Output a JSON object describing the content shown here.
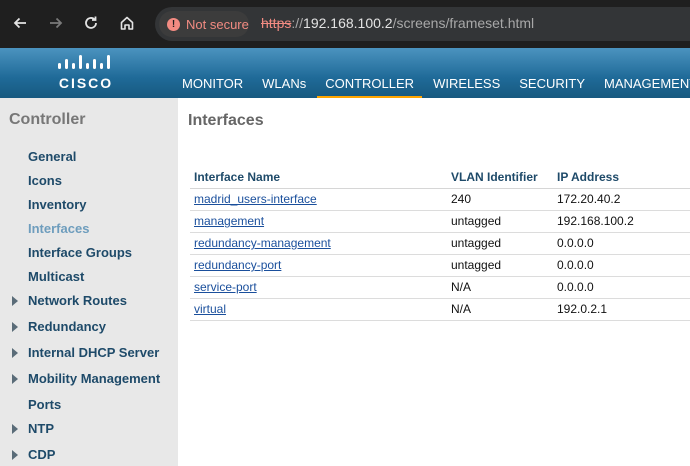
{
  "browser": {
    "security_label": "Not secure",
    "url_scheme": "https",
    "url_sep": "://",
    "url_host": "192.168.100.2",
    "url_path": "/screens/frameset.html"
  },
  "header": {
    "logo_text": "CISCO",
    "brand_color": "#1f6a98",
    "accent_color": "#ffa500",
    "nav": [
      {
        "label": "MONITOR"
      },
      {
        "label": "WLANs"
      },
      {
        "label": "CONTROLLER"
      },
      {
        "label": "WIRELESS"
      },
      {
        "label": "SECURITY"
      },
      {
        "label": "MANAGEMENT"
      }
    ],
    "active_nav": "CONTROLLER"
  },
  "sidebar": {
    "title": "Controller",
    "items": [
      {
        "label": "General",
        "expandable": false
      },
      {
        "label": "Icons",
        "expandable": false
      },
      {
        "label": "Inventory",
        "expandable": false
      },
      {
        "label": "Interfaces",
        "expandable": false,
        "active": true
      },
      {
        "label": "Interface Groups",
        "expandable": false
      },
      {
        "label": "Multicast",
        "expandable": false
      },
      {
        "label": "Network Routes",
        "expandable": true
      },
      {
        "label": "Redundancy",
        "expandable": true
      },
      {
        "label": "Internal DHCP Server",
        "expandable": true
      },
      {
        "label": "Mobility Management",
        "expandable": true
      },
      {
        "label": "Ports",
        "expandable": false
      },
      {
        "label": "NTP",
        "expandable": true
      },
      {
        "label": "CDP",
        "expandable": true
      }
    ]
  },
  "main": {
    "title": "Interfaces",
    "columns": [
      "Interface Name",
      "VLAN Identifier",
      "IP Address"
    ],
    "rows": [
      {
        "name": "madrid_users-interface",
        "vlan": "240",
        "ip": "172.20.40.2"
      },
      {
        "name": "management",
        "vlan": "untagged",
        "ip": "192.168.100.2"
      },
      {
        "name": "redundancy-management",
        "vlan": "untagged",
        "ip": "0.0.0.0"
      },
      {
        "name": "redundancy-port",
        "vlan": "untagged",
        "ip": "0.0.0.0"
      },
      {
        "name": "service-port",
        "vlan": "N/A",
        "ip": "0.0.0.0"
      },
      {
        "name": "virtual",
        "vlan": "N/A",
        "ip": "192.0.2.1"
      }
    ]
  }
}
